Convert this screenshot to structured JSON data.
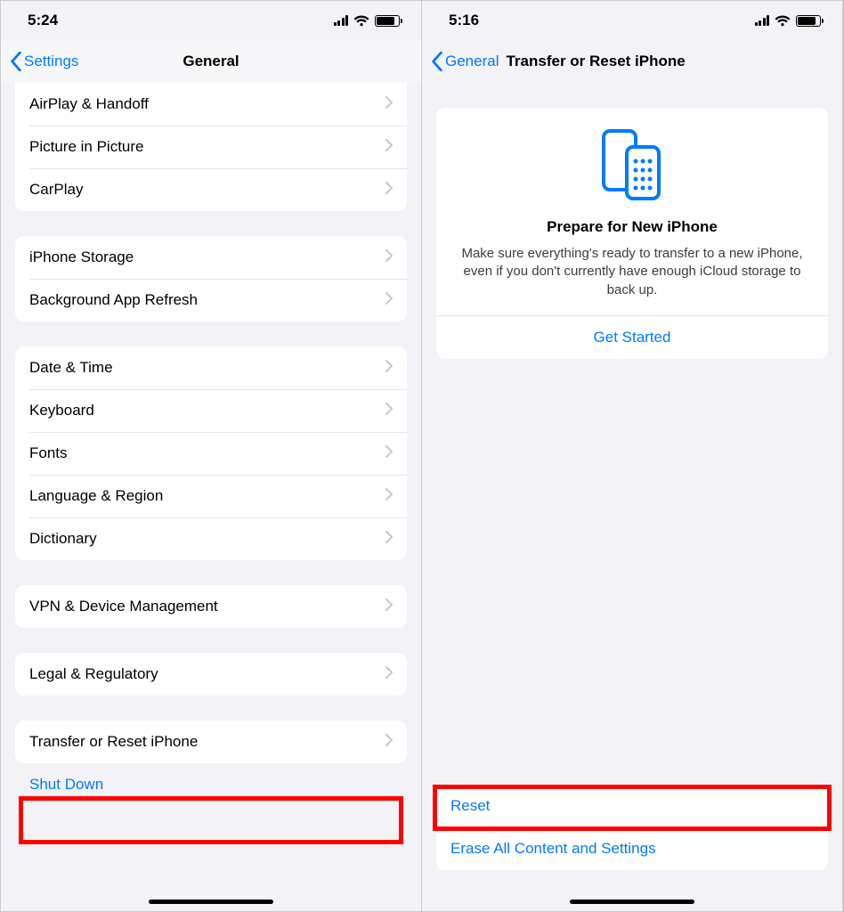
{
  "left": {
    "status_time": "5:24",
    "back_label": "Settings",
    "title": "General",
    "group1": [
      "AirPlay & Handoff",
      "Picture in Picture",
      "CarPlay"
    ],
    "group2": [
      "iPhone Storage",
      "Background App Refresh"
    ],
    "group3": [
      "Date & Time",
      "Keyboard",
      "Fonts",
      "Language & Region",
      "Dictionary"
    ],
    "group4": [
      "VPN & Device Management"
    ],
    "group5": [
      "Legal & Regulatory"
    ],
    "group6": [
      "Transfer or Reset iPhone"
    ],
    "shutdown": "Shut Down"
  },
  "right": {
    "status_time": "5:16",
    "back_label": "General",
    "title": "Transfer or Reset iPhone",
    "card_title": "Prepare for New iPhone",
    "card_body": "Make sure everything's ready to transfer to a new iPhone, even if you don't currently have enough iCloud storage to back up.",
    "card_action": "Get Started",
    "reset": "Reset",
    "erase": "Erase All Content and Settings"
  }
}
